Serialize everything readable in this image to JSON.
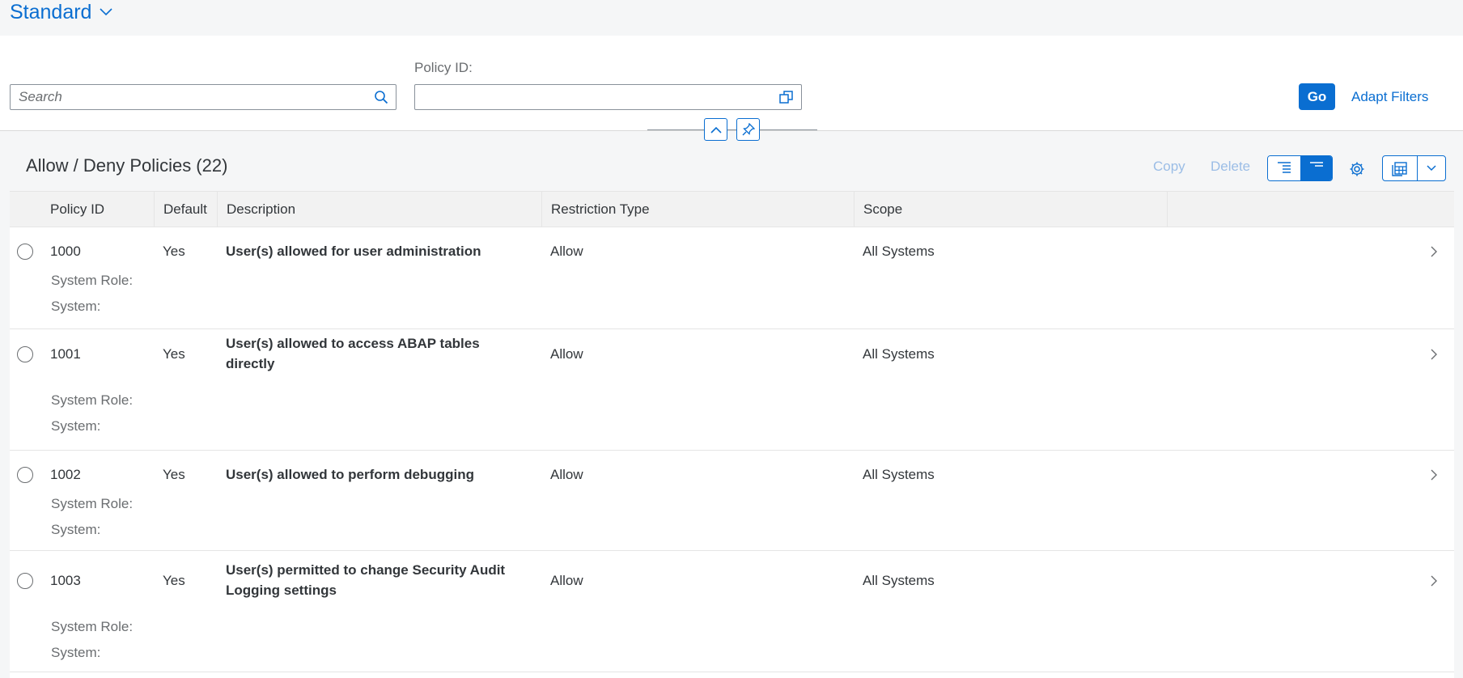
{
  "variant": {
    "label": "Standard"
  },
  "filter_bar": {
    "search_placeholder": "Search",
    "policy_id_label": "Policy ID:",
    "policy_id_value": "",
    "go_label": "Go",
    "adapt_filters_label": "Adapt Filters"
  },
  "table": {
    "title": "Allow / Deny Policies (22)",
    "toolbar": {
      "copy_label": "Copy",
      "delete_label": "Delete"
    },
    "columns": [
      "Policy ID",
      "Default",
      "Description",
      "Restriction Type",
      "Scope"
    ],
    "rows": [
      {
        "policy_id": "1000",
        "default": "Yes",
        "description_line1": "User(s) allowed for user administration",
        "description_line2": "",
        "restriction_type": "Allow",
        "scope": "All Systems",
        "system_role_label": "System Role:",
        "system_label": "System:"
      },
      {
        "policy_id": "1001",
        "default": "Yes",
        "description_line1": "User(s) allowed to access ABAP tables",
        "description_line2": "directly",
        "restriction_type": "Allow",
        "scope": "All Systems",
        "system_role_label": "System Role:",
        "system_label": "System:"
      },
      {
        "policy_id": "1002",
        "default": "Yes",
        "description_line1": "User(s) allowed to perform debugging",
        "description_line2": "",
        "restriction_type": "Allow",
        "scope": "All Systems",
        "system_role_label": "System Role:",
        "system_label": "System:"
      },
      {
        "policy_id": "1003",
        "default": "Yes",
        "description_line1": "User(s) permitted to change Security Audit",
        "description_line2": "Logging settings",
        "restriction_type": "Allow",
        "scope": "All Systems",
        "system_role_label": "System Role:",
        "system_label": "System:"
      }
    ]
  },
  "colors": {
    "accent": "#0a6ed1",
    "text": "#32363a",
    "muted": "#6a6d70",
    "disabled": "#9bbde6"
  },
  "icons": {
    "variant": "chevron-down-icon",
    "search": "search-icon",
    "value_help": "value-help-icon",
    "collapse": "chevron-up-icon",
    "pin": "pin-icon",
    "settings": "gear-icon",
    "export": "export-spreadsheet-icon",
    "row_nav": "chevron-right-icon"
  }
}
